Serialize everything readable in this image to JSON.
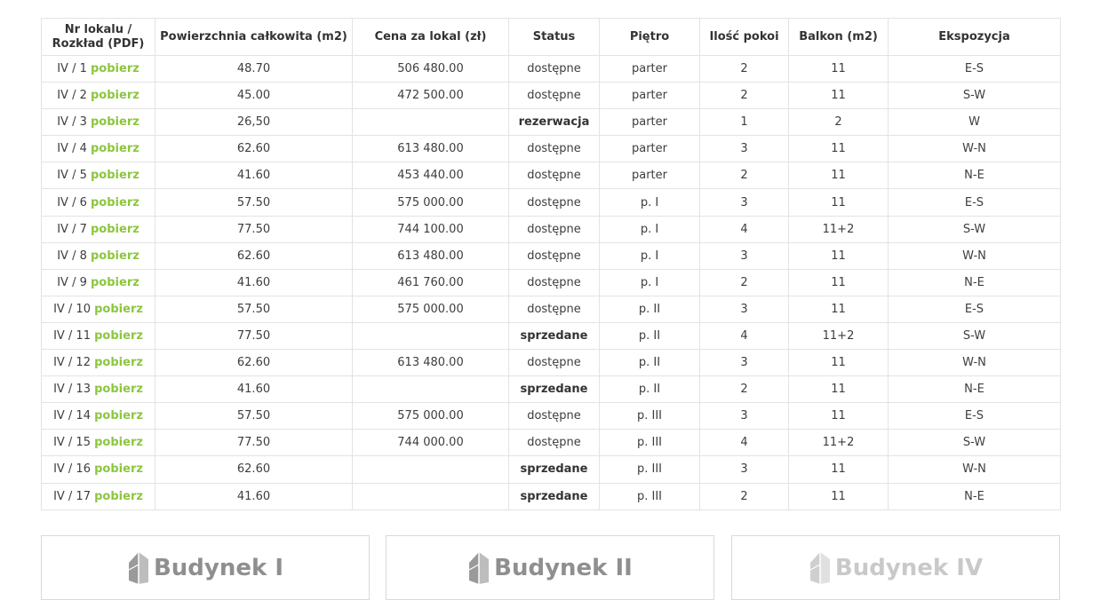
{
  "table": {
    "headers": [
      "Nr lokalu / Rozkład (PDF)",
      "Powierzchnia całkowita (m2)",
      "Cena za lokal (zł)",
      "Status",
      "Piętro",
      "Ilość pokoi",
      "Balkon (m2)",
      "Ekspozycja"
    ],
    "download_label": "pobierz",
    "rows": [
      {
        "nr": "IV / 1",
        "area": "48.70",
        "price": "506 480.00",
        "status": "dostępne",
        "floor": "parter",
        "rooms": "2",
        "balcony": "11",
        "exposure": "E-S"
      },
      {
        "nr": "IV / 2",
        "area": "45.00",
        "price": "472 500.00",
        "status": "dostępne",
        "floor": "parter",
        "rooms": "2",
        "balcony": "11",
        "exposure": "S-W"
      },
      {
        "nr": "IV / 3",
        "area": "26,50",
        "price": "",
        "status": "rezerwacja",
        "floor": "parter",
        "rooms": "1",
        "balcony": "2",
        "exposure": "W"
      },
      {
        "nr": "IV / 4",
        "area": "62.60",
        "price": "613 480.00",
        "status": "dostępne",
        "floor": "parter",
        "rooms": "3",
        "balcony": "11",
        "exposure": "W-N"
      },
      {
        "nr": "IV / 5",
        "area": "41.60",
        "price": "453 440.00",
        "status": "dostępne",
        "floor": "parter",
        "rooms": "2",
        "balcony": "11",
        "exposure": "N-E"
      },
      {
        "nr": "IV / 6",
        "area": "57.50",
        "price": "575 000.00",
        "status": "dostępne",
        "floor": "p. I",
        "rooms": "3",
        "balcony": "11",
        "exposure": "E-S"
      },
      {
        "nr": "IV / 7",
        "area": "77.50",
        "price": "744 100.00",
        "status": "dostępne",
        "floor": "p. I",
        "rooms": "4",
        "balcony": "11+2",
        "exposure": "S-W"
      },
      {
        "nr": "IV / 8",
        "area": "62.60",
        "price": "613 480.00",
        "status": "dostępne",
        "floor": "p. I",
        "rooms": "3",
        "balcony": "11",
        "exposure": "W-N"
      },
      {
        "nr": "IV / 9",
        "area": "41.60",
        "price": "461 760.00",
        "status": "dostępne",
        "floor": "p. I",
        "rooms": "2",
        "balcony": "11",
        "exposure": "N-E"
      },
      {
        "nr": "IV / 10",
        "area": "57.50",
        "price": "575 000.00",
        "status": "dostępne",
        "floor": "p. II",
        "rooms": "3",
        "balcony": "11",
        "exposure": "E-S"
      },
      {
        "nr": "IV / 11",
        "area": "77.50",
        "price": "",
        "status": "sprzedane",
        "floor": "p. II",
        "rooms": "4",
        "balcony": "11+2",
        "exposure": "S-W"
      },
      {
        "nr": "IV / 12",
        "area": "62.60",
        "price": "613 480.00",
        "status": "dostępne",
        "floor": "p. II",
        "rooms": "3",
        "balcony": "11",
        "exposure": "W-N"
      },
      {
        "nr": "IV / 13",
        "area": "41.60",
        "price": "",
        "status": "sprzedane",
        "floor": "p. II",
        "rooms": "2",
        "balcony": "11",
        "exposure": "N-E"
      },
      {
        "nr": "IV / 14",
        "area": "57.50",
        "price": "575 000.00",
        "status": "dostępne",
        "floor": "p. III",
        "rooms": "3",
        "balcony": "11",
        "exposure": "E-S"
      },
      {
        "nr": "IV / 15",
        "area": "77.50",
        "price": "744 000.00",
        "status": "dostępne",
        "floor": "p. III",
        "rooms": "4",
        "balcony": "11+2",
        "exposure": "S-W"
      },
      {
        "nr": "IV / 16",
        "area": "62.60",
        "price": "",
        "status": "sprzedane",
        "floor": "p. III",
        "rooms": "3",
        "balcony": "11",
        "exposure": "W-N"
      },
      {
        "nr": "IV / 17",
        "area": "41.60",
        "price": "",
        "status": "sprzedane",
        "floor": "p. III",
        "rooms": "2",
        "balcony": "11",
        "exposure": "N-E"
      }
    ]
  },
  "buildings": [
    {
      "label": "Budynek I",
      "active": false
    },
    {
      "label": "Budynek II",
      "active": false
    },
    {
      "label": "Budynek IV",
      "active": true
    }
  ],
  "colors": {
    "accent": "#8cc63f",
    "text": "#3d3d3d",
    "border": "#e3e3e3",
    "building_label": "#8f8f8f",
    "building_label_current": "#c9c9c9"
  },
  "icons": {
    "building": "building-logo-icon"
  }
}
